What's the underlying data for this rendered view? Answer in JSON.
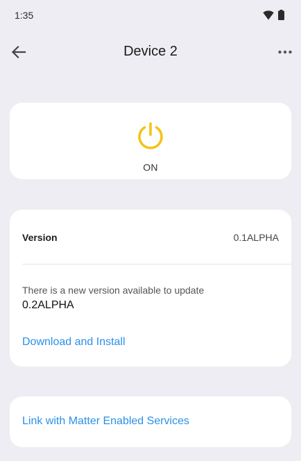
{
  "status_bar": {
    "time": "1:35",
    "icons": [
      "wifi-icon",
      "battery-icon"
    ]
  },
  "app_bar": {
    "title": "Device 2",
    "back_icon": "arrow-back-icon",
    "more_icon": "more-horizontal-icon"
  },
  "power_card": {
    "icon": "power-icon",
    "state": "ON",
    "accent_color": "#f2c518"
  },
  "version_card": {
    "label": "Version",
    "current_version": "0.1ALPHA",
    "update_message": "There is a new version available to update",
    "new_version": "0.2ALPHA",
    "action_label": "Download and Install"
  },
  "matter_card": {
    "link_label": "Link with Matter Enabled Services"
  },
  "colors": {
    "background": "#eeedf3",
    "card": "#ffffff",
    "link": "#2a90e8",
    "power": "#f2c518"
  }
}
